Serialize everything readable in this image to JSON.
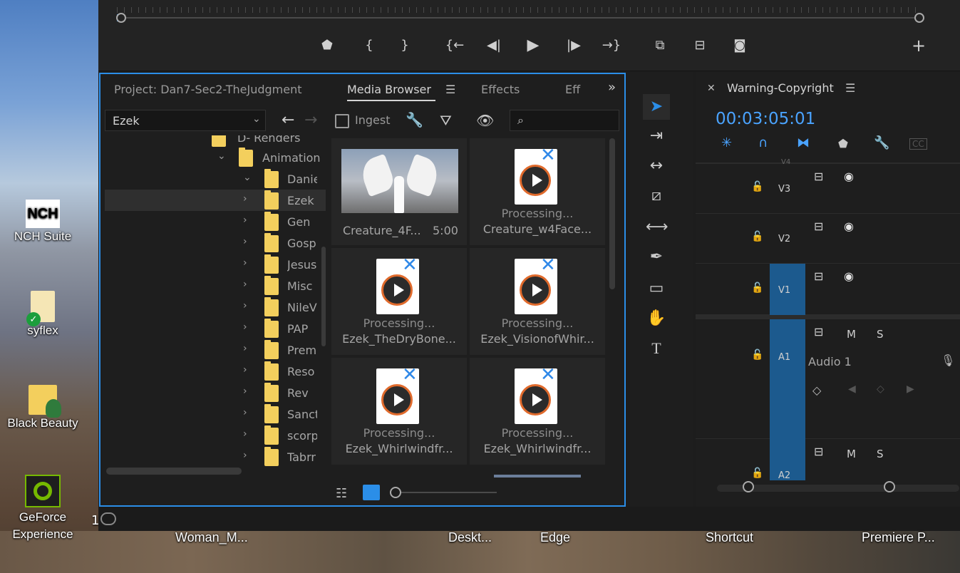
{
  "desktop": {
    "icons": [
      {
        "label": "NCH Suite",
        "icon": "nch-suite-icon"
      },
      {
        "label": "syflex",
        "icon": "folder-check-icon"
      },
      {
        "label": "Black Beauty",
        "icon": "folder-user-icon"
      },
      {
        "label": "GeForce Experience",
        "icon": "geforce-icon"
      }
    ],
    "taskbar_labels": [
      "Woman_M...",
      "Deskt...",
      "Edge",
      "Shortcut",
      "Premiere P..."
    ],
    "partial_label": "1"
  },
  "program_monitor": {
    "buttons": [
      "marker",
      "mark-in",
      "mark-out",
      "go-to-in",
      "step-back",
      "play",
      "step-forward",
      "go-to-out",
      "insert",
      "overwrite",
      "export-frame",
      "add"
    ]
  },
  "project_panel": {
    "tabs": [
      "Project: Dan7-Sec2-TheJudgment",
      "Media Browser",
      "Effects",
      "Eff"
    ],
    "active_tab": "Media Browser",
    "location": "Ezek",
    "ingest_label": "Ingest",
    "search_placeholder": "",
    "tree": {
      "partial_top": "D- Renders",
      "parent": "Animation",
      "items": [
        "Danie",
        "Ezek",
        "Gen",
        "Gosp",
        "Jesus",
        "Misc",
        "NileV",
        "PAP",
        "Prem",
        "Reso",
        "Rev",
        "Sanct",
        "scorp",
        "Tabrr"
      ],
      "selected": "Ezek"
    },
    "media": [
      {
        "status": "",
        "name": "Creature_4F...",
        "duration": "5:00",
        "type": "angel-thumbnail"
      },
      {
        "status": "Processing...",
        "name": "Creature_w4Face...",
        "type": "processing"
      },
      {
        "status": "Processing...",
        "name": "Ezek_TheDryBone...",
        "type": "processing"
      },
      {
        "status": "Processing...",
        "name": "Ezek_VisionofWhir...",
        "type": "processing"
      },
      {
        "status": "Processing...",
        "name": "Ezek_Whirlwindfr...",
        "type": "processing"
      },
      {
        "status": "Processing...",
        "name": "Ezek_Whirlwindfr...",
        "type": "processing"
      }
    ]
  },
  "timeline": {
    "sequence_name": "Warning-Copyright",
    "timecode": "00:03:05:01",
    "tracks": [
      {
        "name": "V3",
        "kind": "video"
      },
      {
        "name": "V2",
        "kind": "video"
      },
      {
        "name": "V1",
        "kind": "video",
        "target": true
      },
      {
        "name": "A1",
        "kind": "audio",
        "target": true,
        "label": "Audio 1",
        "m": "M",
        "s": "S"
      },
      {
        "name": "A2",
        "kind": "audio",
        "target": true,
        "m": "M",
        "s": "S"
      }
    ],
    "partial_top_track": "V4"
  },
  "colors": {
    "accent": "#2b8ee8",
    "timecode": "#4aa3ff",
    "folder": "#f3cf5d",
    "track_target": "#1c5a8e"
  }
}
